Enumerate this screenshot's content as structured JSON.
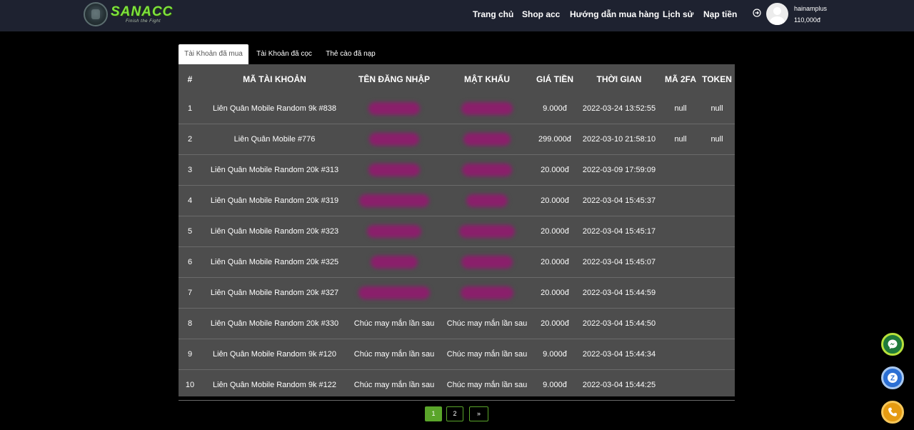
{
  "header": {
    "logo_text": "SANACC",
    "logo_subtitle": "Finish the Fight",
    "nav": [
      "Trang chủ",
      "Shop acc",
      "Hướng dẫn mua hàng",
      "Lịch sử",
      "Nạp tiền"
    ],
    "user": {
      "name": "hainamplus",
      "balance": "110,000đ"
    }
  },
  "tabs": [
    {
      "label": "Tài Khoản đã mua",
      "active": true
    },
    {
      "label": "Tài Khoản đã cọc",
      "active": false
    },
    {
      "label": "Thẻ cào đã nạp",
      "active": false
    }
  ],
  "table": {
    "columns": [
      "#",
      "MÃ TÀI KHOẢN",
      "TÊN ĐĂNG NHẬP",
      "MẬT KHẨU",
      "GIÁ TIỀN",
      "THỜI GIAN",
      "MÃ 2FA",
      "TOKEN"
    ],
    "rows": [
      {
        "num": "1",
        "code": "Liên Quân Mobile Random 9k #838",
        "user": "",
        "pass": "",
        "price": "9.000đ",
        "time": "2022-03-24 13:52:55",
        "twofa": "null",
        "token": "null"
      },
      {
        "num": "2",
        "code": "Liên Quân Mobile #776",
        "user": "",
        "pass": "",
        "price": "299.000đ",
        "time": "2022-03-10 21:58:10",
        "twofa": "null",
        "token": "null"
      },
      {
        "num": "3",
        "code": "Liên Quân Mobile Random 20k #313",
        "user": "",
        "pass": "",
        "price": "20.000đ",
        "time": "2022-03-09 17:59:09",
        "twofa": "",
        "token": ""
      },
      {
        "num": "4",
        "code": "Liên Quân Mobile Random 20k #319",
        "user": "",
        "pass": "",
        "price": "20.000đ",
        "time": "2022-03-04 15:45:37",
        "twofa": "",
        "token": ""
      },
      {
        "num": "5",
        "code": "Liên Quân Mobile Random 20k #323",
        "user": "",
        "pass": "",
        "price": "20.000đ",
        "time": "2022-03-04 15:45:17",
        "twofa": "",
        "token": ""
      },
      {
        "num": "6",
        "code": "Liên Quân Mobile Random 20k #325",
        "user": "",
        "pass": "",
        "price": "20.000đ",
        "time": "2022-03-04 15:45:07",
        "twofa": "",
        "token": ""
      },
      {
        "num": "7",
        "code": "Liên Quân Mobile Random 20k #327",
        "user": "",
        "pass": "",
        "price": "20.000đ",
        "time": "2022-03-04 15:44:59",
        "twofa": "",
        "token": ""
      },
      {
        "num": "8",
        "code": "Liên Quân Mobile Random 20k #330",
        "user": "Chúc may mắn lần sau",
        "pass": "Chúc may mắn lần sau",
        "price": "20.000đ",
        "time": "2022-03-04 15:44:50",
        "twofa": "",
        "token": ""
      },
      {
        "num": "9",
        "code": "Liên Quân Mobile Random 9k #120",
        "user": "Chúc may mắn lần sau",
        "pass": "Chúc may mắn lần sau",
        "price": "9.000đ",
        "time": "2022-03-04 15:44:34",
        "twofa": "",
        "token": ""
      },
      {
        "num": "10",
        "code": "Liên Quân Mobile Random 9k #122",
        "user": "Chúc may mắn lần sau",
        "pass": "Chúc may mắn lần sau",
        "price": "9.000đ",
        "time": "2022-03-04 15:44:25",
        "twofa": "",
        "token": ""
      }
    ]
  },
  "pagination": {
    "pages": [
      "1",
      "2"
    ],
    "current": "1",
    "next_label": "»"
  },
  "floating": {
    "icons": [
      "messenger-icon",
      "zalo-icon",
      "phone-icon"
    ],
    "zalo_letter": "Z"
  },
  "colors": {
    "header_bg": "#1e2230",
    "accent_green": "#5aa52a",
    "logo_green": "#7ee33b",
    "table_bg": "#4d4d4d",
    "redaction": "#8a1f6b"
  }
}
